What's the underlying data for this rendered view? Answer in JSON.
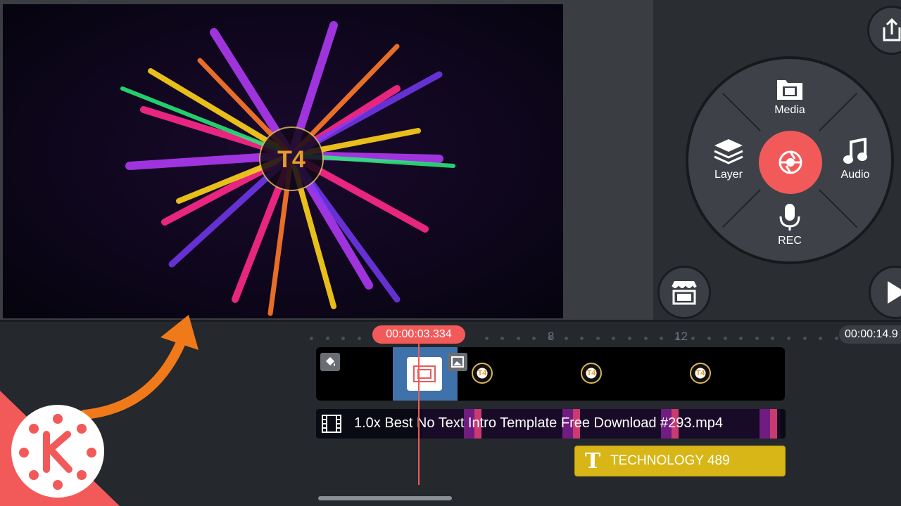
{
  "wheel": {
    "media_label": "Media",
    "layer_label": "Layer",
    "audio_label": "Audio",
    "rec_label": "REC"
  },
  "timeline": {
    "playhead_time": "00:00:03.334",
    "end_time": "00:00:14.9",
    "ruler_marks": [
      "8",
      "12"
    ],
    "video_clip_label": "1.0x Best No Text Intro Template Free Download #293.mp4",
    "text_clip_label": "TECHNOLOGY 489"
  },
  "preview": {
    "watermark_text": "T4"
  },
  "colors": {
    "accent": "#f25a5a",
    "text_clip": "#d9b617",
    "layer_selection": "#4a86c8",
    "arrow": "#f07a1a"
  },
  "icons": [
    "export-icon",
    "media-folder-icon",
    "layers-icon",
    "music-note-icon",
    "microphone-icon",
    "camera-shutter-icon",
    "store-icon",
    "play-icon",
    "paint-bucket-icon",
    "image-icon",
    "film-icon",
    "text-t-icon",
    "kinemaster-logo"
  ]
}
